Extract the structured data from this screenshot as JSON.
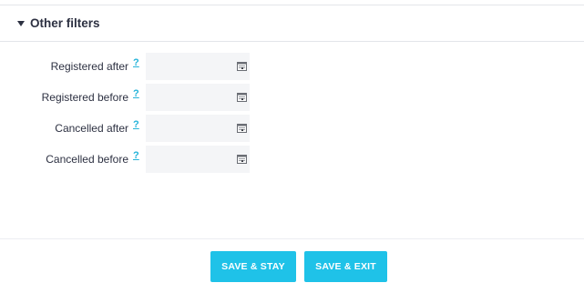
{
  "section": {
    "title": "Other filters",
    "expanded": true
  },
  "filters": [
    {
      "label": "Registered after",
      "help": "?",
      "value": "",
      "icon": "calendar-icon"
    },
    {
      "label": "Registered before",
      "help": "?",
      "value": "",
      "icon": "calendar-icon"
    },
    {
      "label": "Cancelled after",
      "help": "?",
      "value": "",
      "icon": "calendar-icon"
    },
    {
      "label": "Cancelled before",
      "help": "?",
      "value": "",
      "icon": "calendar-icon"
    }
  ],
  "actions": {
    "save_stay_label": "SAVE & STAY",
    "save_exit_label": "SAVE & EXIT"
  },
  "colors": {
    "accent": "#1fc2e8",
    "help_link": "#23b3d9",
    "text": "#2d3142",
    "field_bg": "#f4f5f7"
  }
}
